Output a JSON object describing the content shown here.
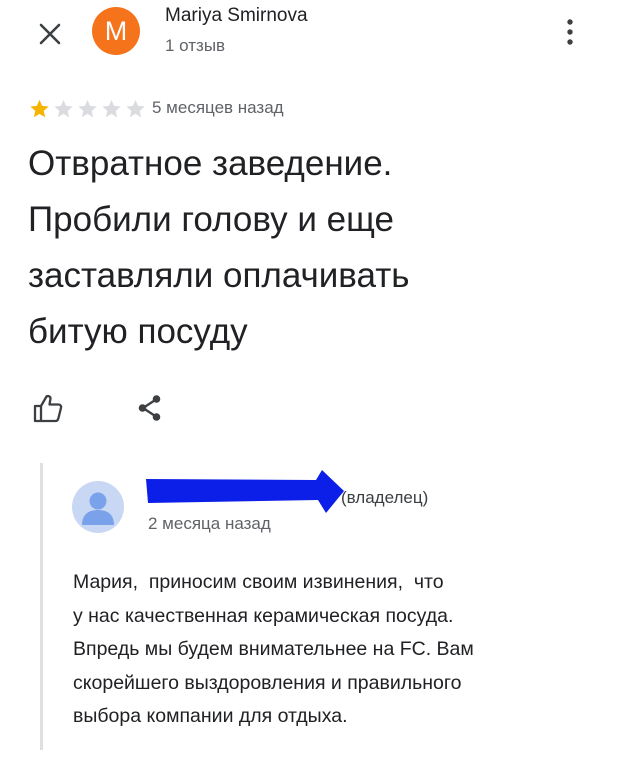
{
  "header": {
    "avatar_letter": "M",
    "avatar_color": "#f5731b",
    "reviewer_name": "Mariya Smirnova",
    "review_count": "1 отзыв",
    "close_icon": "close-icon",
    "menu_icon": "more-vert-icon"
  },
  "review": {
    "rating": 1,
    "rating_max": 5,
    "star_filled_color": "#f6b400",
    "star_empty_color": "#dadce0",
    "date": "5 месяцев назад",
    "text_lines": [
      "Отвратное заведение.",
      "Пробили голову и еще",
      "заставляли оплачивать",
      "битую посуду"
    ]
  },
  "actions": {
    "like_icon": "thumb-up-icon",
    "share_icon": "share-icon"
  },
  "owner_reply": {
    "owner_label": "(владелец)",
    "redaction_color": "#0c1fe8",
    "date": "2 месяца назад",
    "text_lines": [
      "Мария,  приносим своим извинения,  что",
      "у нас качественная керамическая посуда.",
      "Впредь мы будем внимательнее на FC. Вам",
      "скорейшего выздоровления и правильного",
      "выбора компании для отдыха."
    ]
  }
}
